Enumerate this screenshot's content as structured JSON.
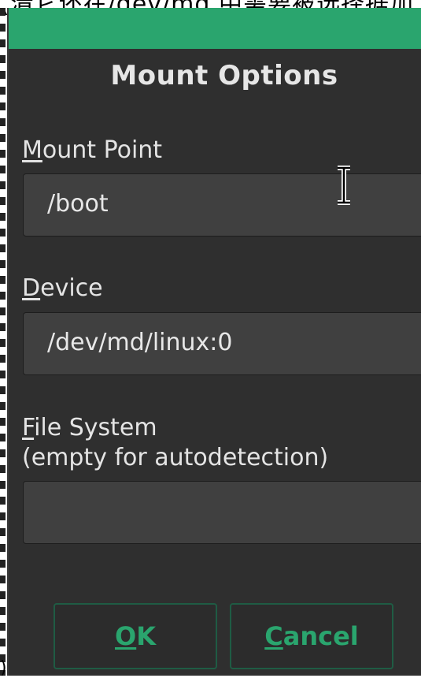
{
  "background_caption": {
    "text": "(清它还在/dev/md 中需要被选择据加"
  },
  "dialog": {
    "title": "Mount Options",
    "accent_color": "#2aa56e",
    "fields": [
      {
        "mnemonic": "M",
        "rest": "ount Point",
        "value": "/boot",
        "subtitle": ""
      },
      {
        "mnemonic": "D",
        "rest": "evice",
        "value": "/dev/md/linux:0",
        "subtitle": ""
      },
      {
        "mnemonic": "F",
        "rest": "ile System",
        "value": "",
        "subtitle": "(empty for autodetection)"
      }
    ],
    "buttons": {
      "ok": {
        "mnemonic": "O",
        "rest": "K"
      },
      "cancel": {
        "mnemonic": "C",
        "rest": "ancel"
      }
    }
  },
  "cursor": {
    "icon": "text-ibeam-cursor-icon"
  }
}
